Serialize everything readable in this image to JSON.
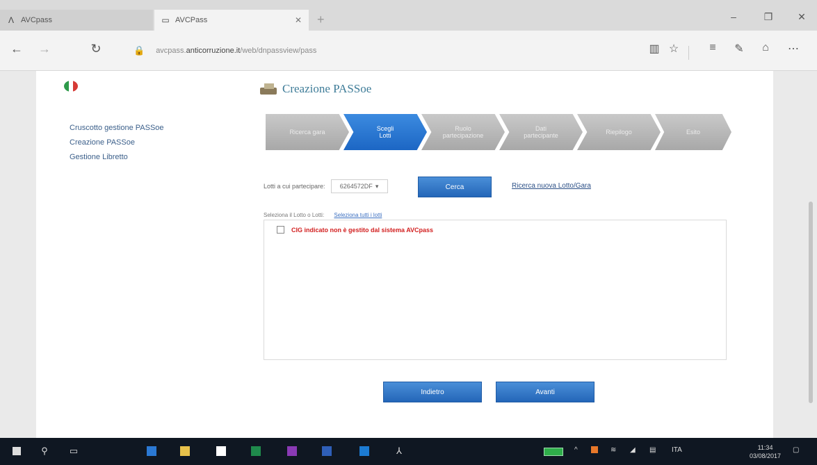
{
  "browser": {
    "tabs": [
      {
        "label": "AVCpass",
        "icon": "avcp-icon"
      },
      {
        "label": "AVCPass",
        "icon": "page-icon"
      }
    ],
    "url_prefix": "avcpass.",
    "url_host": "anticorruzione.it",
    "url_path": "/web/dnpassview/pass"
  },
  "sidebar": {
    "items": [
      {
        "label": "Cruscotto gestione PASSoe"
      },
      {
        "label": "Creazione PASSoe"
      },
      {
        "label": "Gestione Libretto"
      }
    ]
  },
  "main": {
    "title": "Creazione PASSoe",
    "steps": [
      {
        "label": "Ricerca gara"
      },
      {
        "label": "Scegli\nLotti"
      },
      {
        "label": "Ruolo\npartecipazione"
      },
      {
        "label": "Dati\npartecipante"
      },
      {
        "label": "Riepilogo"
      },
      {
        "label": "Esito"
      }
    ],
    "lots_label": "Lotti a cui partecipare:",
    "lots_select": "6264572DF",
    "search_button": "Cerca",
    "new_search_link": "Ricerca nuova Lotto/Gara",
    "select_label": "Seleziona il Lotto o Lotti:",
    "select_all_link": "Seleziona tutti i lotti",
    "list_items": [
      {
        "text": "CIG indicato non è gestito dal sistema AVCpass"
      }
    ],
    "back_button": "Indietro",
    "next_button": "Avanti"
  },
  "taskbar": {
    "lang": "ITA",
    "time": "11:34",
    "date": "03/08/2017"
  }
}
